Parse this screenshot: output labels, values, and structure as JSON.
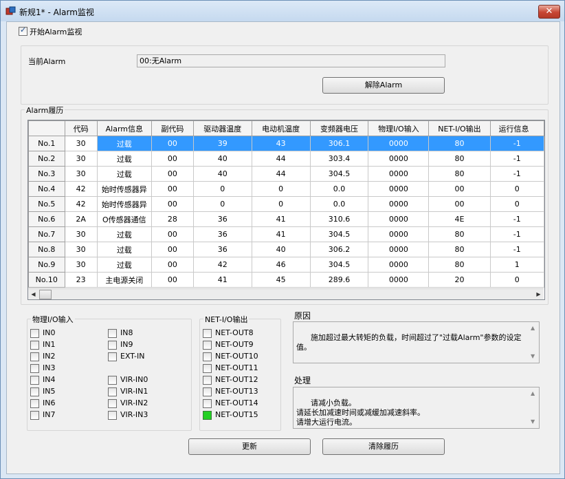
{
  "window": {
    "title": "新规1* - Alarm监视",
    "close_glyph": "✕"
  },
  "monitor": {
    "label": "开始Alarm监视",
    "checked": true
  },
  "current": {
    "label": "当前Alarm",
    "value": "00:无Alarm",
    "reset_button": "解除Alarm"
  },
  "history": {
    "title": "Alarm履历",
    "columns": [
      "代码",
      "Alarm信息",
      "副代码",
      "驱动器温度",
      "电动机温度",
      "变频器电压",
      "物理I/O输入",
      "NET-I/O输出",
      "运行信息"
    ],
    "rows": [
      {
        "no": "No.1",
        "cells": [
          "30",
          "过载",
          "00",
          "39",
          "43",
          "306.1",
          "0000",
          "80",
          "-1"
        ]
      },
      {
        "no": "No.2",
        "cells": [
          "30",
          "过载",
          "00",
          "40",
          "44",
          "303.4",
          "0000",
          "80",
          "-1"
        ]
      },
      {
        "no": "No.3",
        "cells": [
          "30",
          "过载",
          "00",
          "40",
          "44",
          "304.5",
          "0000",
          "80",
          "-1"
        ]
      },
      {
        "no": "No.4",
        "cells": [
          "42",
          "始时传感器异",
          "00",
          "0",
          "0",
          "0.0",
          "0000",
          "00",
          "0"
        ]
      },
      {
        "no": "No.5",
        "cells": [
          "42",
          "始时传感器异",
          "00",
          "0",
          "0",
          "0.0",
          "0000",
          "00",
          "0"
        ]
      },
      {
        "no": "No.6",
        "cells": [
          "2A",
          "O传感器通信",
          "28",
          "36",
          "41",
          "310.6",
          "0000",
          "4E",
          "-1"
        ]
      },
      {
        "no": "No.7",
        "cells": [
          "30",
          "过载",
          "00",
          "36",
          "41",
          "304.5",
          "0000",
          "80",
          "-1"
        ]
      },
      {
        "no": "No.8",
        "cells": [
          "30",
          "过载",
          "00",
          "36",
          "40",
          "306.2",
          "0000",
          "80",
          "-1"
        ]
      },
      {
        "no": "No.9",
        "cells": [
          "30",
          "过载",
          "00",
          "42",
          "46",
          "304.5",
          "0000",
          "80",
          "1"
        ]
      },
      {
        "no": "No.10",
        "cells": [
          "23",
          "主电源关闭",
          "00",
          "41",
          "45",
          "289.6",
          "0000",
          "20",
          "0"
        ]
      }
    ]
  },
  "phys_io": {
    "title": "物理I/O输入",
    "left": [
      "IN0",
      "IN1",
      "IN2",
      "IN3",
      "IN4",
      "IN5",
      "IN6",
      "IN7"
    ],
    "right_top": [
      "IN8",
      "IN9",
      "EXT-IN"
    ],
    "right_bottom": [
      "VIR-IN0",
      "VIR-IN1",
      "VIR-IN2",
      "VIR-IN3"
    ]
  },
  "net_io": {
    "title": "NET-I/O输出",
    "items": [
      "NET-OUT8",
      "NET-OUT9",
      "NET-OUT10",
      "NET-OUT11",
      "NET-OUT12",
      "NET-OUT13",
      "NET-OUT14",
      "NET-OUT15"
    ],
    "active_index": 7,
    "active_color": "#22d022"
  },
  "cause": {
    "label": "原因",
    "text": "施加超过最大转矩的负载，时间超过了\"过载Alarm\"参数的设定值。"
  },
  "action": {
    "label": "处理",
    "text": "请减小负载。\n请延长加减速时间或减缓加减速斜率。\n请增大运行电流。"
  },
  "buttons": {
    "update": "更新",
    "clear": "清除履历"
  }
}
